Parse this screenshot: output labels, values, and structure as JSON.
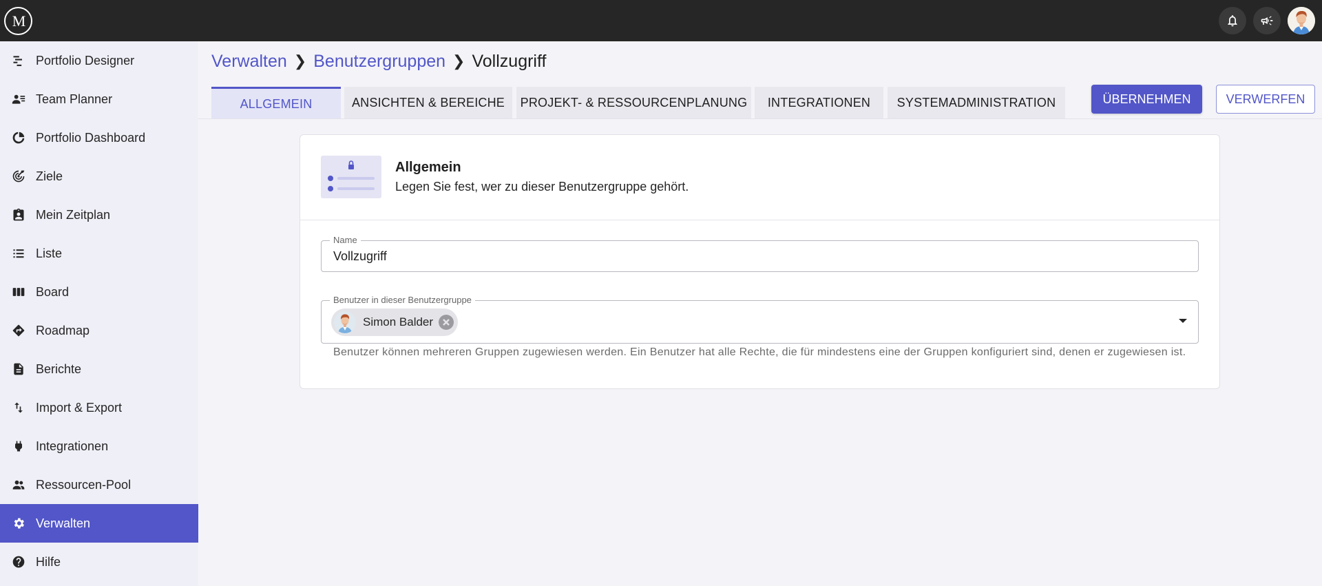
{
  "topbar": {
    "logo_text": "M",
    "icons": [
      "bell-icon",
      "megaphone-icon"
    ]
  },
  "sidebar": {
    "items": [
      {
        "label": "Portfolio Designer",
        "icon": "portfolio-designer-icon"
      },
      {
        "label": "Team Planner",
        "icon": "team-planner-icon"
      },
      {
        "label": "Portfolio Dashboard",
        "icon": "pie-chart-icon"
      },
      {
        "label": "Ziele",
        "icon": "target-icon"
      },
      {
        "label": "Mein Zeitplan",
        "icon": "clipboard-user-icon"
      },
      {
        "label": "Liste",
        "icon": "list-icon"
      },
      {
        "label": "Board",
        "icon": "board-columns-icon"
      },
      {
        "label": "Roadmap",
        "icon": "directions-icon"
      },
      {
        "label": "Berichte",
        "icon": "document-icon"
      },
      {
        "label": "Import & Export",
        "icon": "swap-vertical-icon"
      },
      {
        "label": "Integrationen",
        "icon": "plug-icon"
      },
      {
        "label": "Ressourcen-Pool",
        "icon": "people-icon"
      },
      {
        "label": "Verwalten",
        "icon": "gear-icon",
        "active": true
      },
      {
        "label": "Hilfe",
        "icon": "help-circle-icon"
      }
    ]
  },
  "breadcrumb": {
    "items": [
      "Verwalten",
      "Benutzergruppen"
    ],
    "current": "Vollzugriff"
  },
  "tabs": [
    {
      "label": "ALLGEMEIN",
      "active": true
    },
    {
      "label": "ANSICHTEN & BEREICHE"
    },
    {
      "label": "PROJEKT- & RESSOURCENPLANUNG"
    },
    {
      "label": "INTEGRATIONEN"
    },
    {
      "label": "SYSTEMADMINISTRATION"
    }
  ],
  "actions": {
    "apply_label": "ÜBERNEHMEN",
    "discard_label": "VERWERFEN"
  },
  "card": {
    "title": "Allgemein",
    "subtitle": "Legen Sie fest, wer zu dieser Benutzergruppe gehört.",
    "name_field": {
      "label": "Name",
      "value": "Vollzugriff"
    },
    "users_field": {
      "label": "Benutzer in dieser Benutzergruppe",
      "chips": [
        "Simon Balder"
      ],
      "helper": "Benutzer können mehreren Gruppen zugewiesen werden. Ein Benutzer hat alle Rechte, die für mindestens eine der Gruppen konfiguriert sind, denen er zugewiesen ist."
    }
  },
  "colors": {
    "accent": "#5256c8",
    "topbar": "#262626",
    "sidebar_bg": "#efeff7",
    "page_bg": "#f4f4f8"
  }
}
